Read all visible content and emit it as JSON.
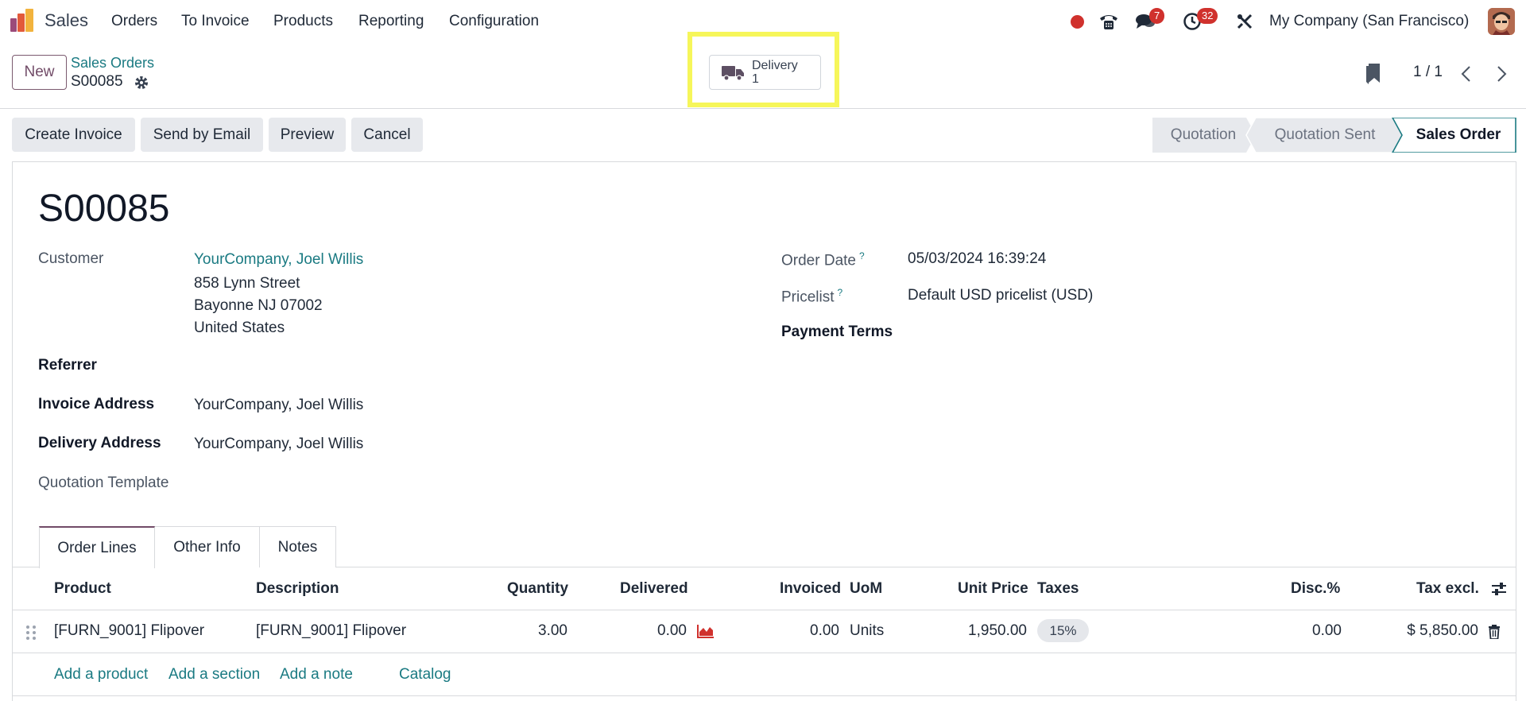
{
  "navbar": {
    "app_name": "Sales",
    "menu": [
      "Orders",
      "To Invoice",
      "Products",
      "Reporting",
      "Configuration"
    ],
    "messages_count": "7",
    "activities_count": "32",
    "company": "My Company (San Francisco)"
  },
  "control_panel": {
    "new_label": "New",
    "breadcrumb": "Sales Orders",
    "record_name": "S00085",
    "smart_button": {
      "label": "Delivery",
      "count": "1"
    },
    "pager": "1 / 1"
  },
  "actions": [
    "Create Invoice",
    "Send by Email",
    "Preview",
    "Cancel"
  ],
  "stages": [
    "Quotation",
    "Quotation Sent",
    "Sales Order"
  ],
  "form": {
    "title": "S00085",
    "customer_label": "Customer",
    "customer_name": "YourCompany, Joel Willis",
    "customer_address": [
      "858 Lynn Street",
      "Bayonne NJ 07002",
      "United States"
    ],
    "referrer_label": "Referrer",
    "invoice_address_label": "Invoice Address",
    "invoice_address": "YourCompany, Joel Willis",
    "delivery_address_label": "Delivery Address",
    "delivery_address": "YourCompany, Joel Willis",
    "quotation_template_label": "Quotation Template",
    "order_date_label": "Order Date",
    "order_date": "05/03/2024 16:39:24",
    "pricelist_label": "Pricelist",
    "pricelist": "Default USD pricelist (USD)",
    "payment_terms_label": "Payment Terms",
    "help_mark": "?"
  },
  "tabs": [
    "Order Lines",
    "Other Info",
    "Notes"
  ],
  "table": {
    "headers": {
      "product": "Product",
      "description": "Description",
      "quantity": "Quantity",
      "delivered": "Delivered",
      "invoiced": "Invoiced",
      "uom": "UoM",
      "unit_price": "Unit Price",
      "taxes": "Taxes",
      "disc": "Disc.%",
      "tax_excl": "Tax excl."
    },
    "rows": [
      {
        "product": "[FURN_9001] Flipover",
        "description": "[FURN_9001] Flipover",
        "quantity": "3.00",
        "delivered": "0.00",
        "invoiced": "0.00",
        "uom": "Units",
        "unit_price": "1,950.00",
        "taxes": "15%",
        "disc": "0.00",
        "tax_excl": "$ 5,850.00"
      }
    ],
    "add_links": [
      "Add a product",
      "Add a section",
      "Add a note",
      "Catalog"
    ]
  }
}
